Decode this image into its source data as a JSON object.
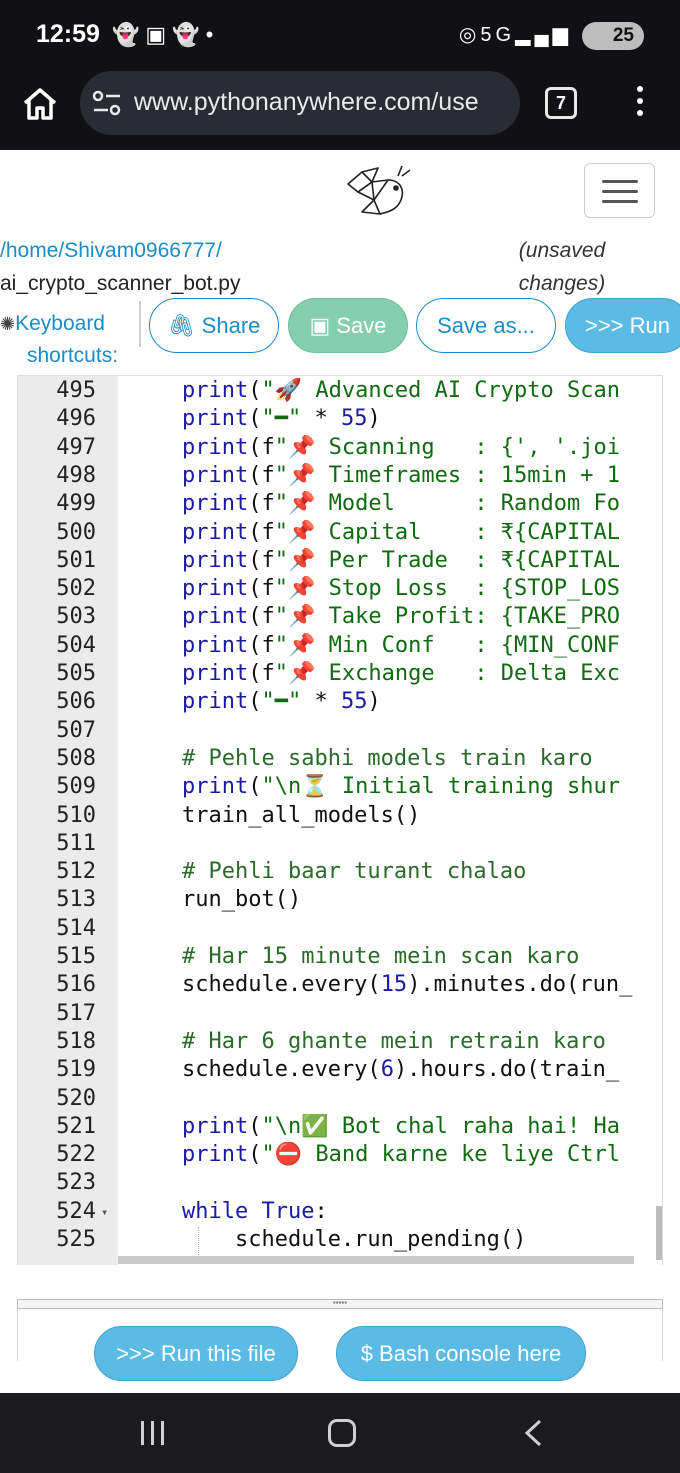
{
  "status": {
    "time": "12:59",
    "battery": "25"
  },
  "browser": {
    "url": "www.pythonanywhere.com/use",
    "tab_count": "7"
  },
  "file": {
    "path_root": "/home/",
    "path_user": "Shivam0966777",
    "path_sep": "/",
    "filename": "ai_crypto_scanner_bot.py",
    "unsaved_line1": "(unsaved",
    "unsaved_line2": "changes)"
  },
  "toolbar": {
    "keyboard_line1": "Keyboard",
    "keyboard_line2": "shortcuts:",
    "share": "Share",
    "save": "Save",
    "save_as": "Save as...",
    "run": ">>> Run"
  },
  "code_lines": [
    {
      "n": "495",
      "t": "print(\"🚀 Advanced AI Crypto Scan"
    },
    {
      "n": "496",
      "t": "print(\"━\" * 55)"
    },
    {
      "n": "497",
      "t": "print(f\"📌 Scanning   : {', '.joi"
    },
    {
      "n": "498",
      "t": "print(f\"📌 Timeframes : 15min + 1"
    },
    {
      "n": "499",
      "t": "print(f\"📌 Model      : Random Fo"
    },
    {
      "n": "500",
      "t": "print(f\"📌 Capital    : ₹{CAPITAL"
    },
    {
      "n": "501",
      "t": "print(f\"📌 Per Trade  : ₹{CAPITAL"
    },
    {
      "n": "502",
      "t": "print(f\"📌 Stop Loss  : {STOP_LOS"
    },
    {
      "n": "503",
      "t": "print(f\"📌 Take Profit: {TAKE_PRO"
    },
    {
      "n": "504",
      "t": "print(f\"📌 Min Conf   : {MIN_CONF"
    },
    {
      "n": "505",
      "t": "print(f\"📌 Exchange   : Delta Exc"
    },
    {
      "n": "506",
      "t": "print(\"━\" * 55)"
    },
    {
      "n": "507",
      "t": ""
    },
    {
      "n": "508",
      "t": "# Pehle sabhi models train karo"
    },
    {
      "n": "509",
      "t": "print(\"\\n⏳ Initial training shur"
    },
    {
      "n": "510",
      "t": "train_all_models()"
    },
    {
      "n": "511",
      "t": ""
    },
    {
      "n": "512",
      "t": "# Pehli baar turant chalao"
    },
    {
      "n": "513",
      "t": "run_bot()"
    },
    {
      "n": "514",
      "t": ""
    },
    {
      "n": "515",
      "t": "# Har 15 minute mein scan karo"
    },
    {
      "n": "516",
      "t": "schedule.every(15).minutes.do(run_"
    },
    {
      "n": "517",
      "t": ""
    },
    {
      "n": "518",
      "t": "# Har 6 ghante mein retrain karo"
    },
    {
      "n": "519",
      "t": "schedule.every(6).hours.do(train_"
    },
    {
      "n": "520",
      "t": ""
    },
    {
      "n": "521",
      "t": "print(\"\\n✅ Bot chal raha hai! Ha"
    },
    {
      "n": "522",
      "t": "print(\"⛔ Band karne ke liye Ctrl"
    },
    {
      "n": "523",
      "t": ""
    },
    {
      "n": "524",
      "t": "while True:"
    },
    {
      "n": "525",
      "t": "    schedule.run_pending()"
    }
  ],
  "bottom": {
    "run_file": ">>> Run this file",
    "bash": "$ Bash console here"
  },
  "colors": {
    "link": "#1b8cc9",
    "save_btn": "#86cfae",
    "run_btn": "#5bbbe5"
  }
}
